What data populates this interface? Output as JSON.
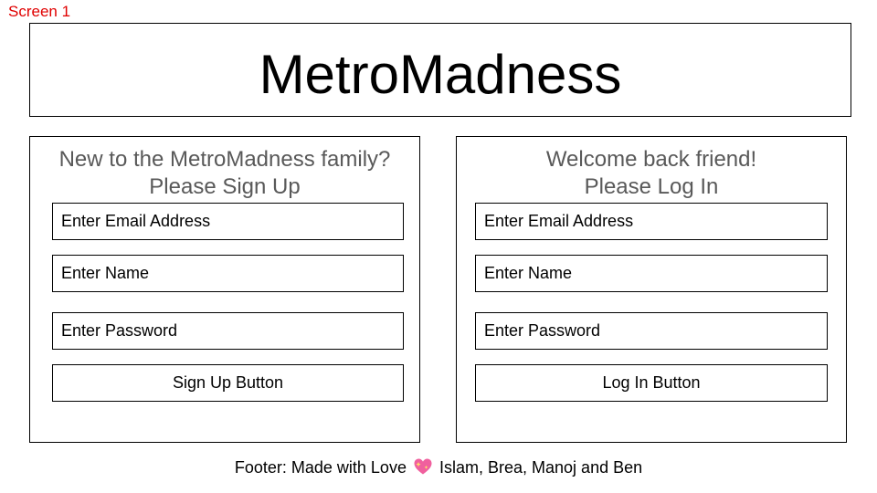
{
  "screen_label": "Screen 1",
  "app": {
    "title": "MetroMadness"
  },
  "signup": {
    "heading_line1": "New to the MetroMadness family?",
    "heading_line2": "Please Sign Up",
    "email_placeholder": "Enter Email Address",
    "name_placeholder": "Enter Name",
    "password_placeholder": "Enter Password",
    "button_label": "Sign Up Button"
  },
  "login": {
    "heading_line1": "Welcome back friend!",
    "heading_line2": "Please Log In",
    "email_placeholder": "Enter Email Address",
    "name_placeholder": "Enter Name",
    "password_placeholder": "Enter Password",
    "button_label": "Log In Button"
  },
  "footer": {
    "prefix": "Footer: Made with Love",
    "heart_icon": "sparkling-heart-icon",
    "names": "Islam, Brea, Manoj and Ben"
  },
  "colors": {
    "screen_label": "#e00000",
    "heading_text": "#595959",
    "heart": "#f0609e"
  }
}
